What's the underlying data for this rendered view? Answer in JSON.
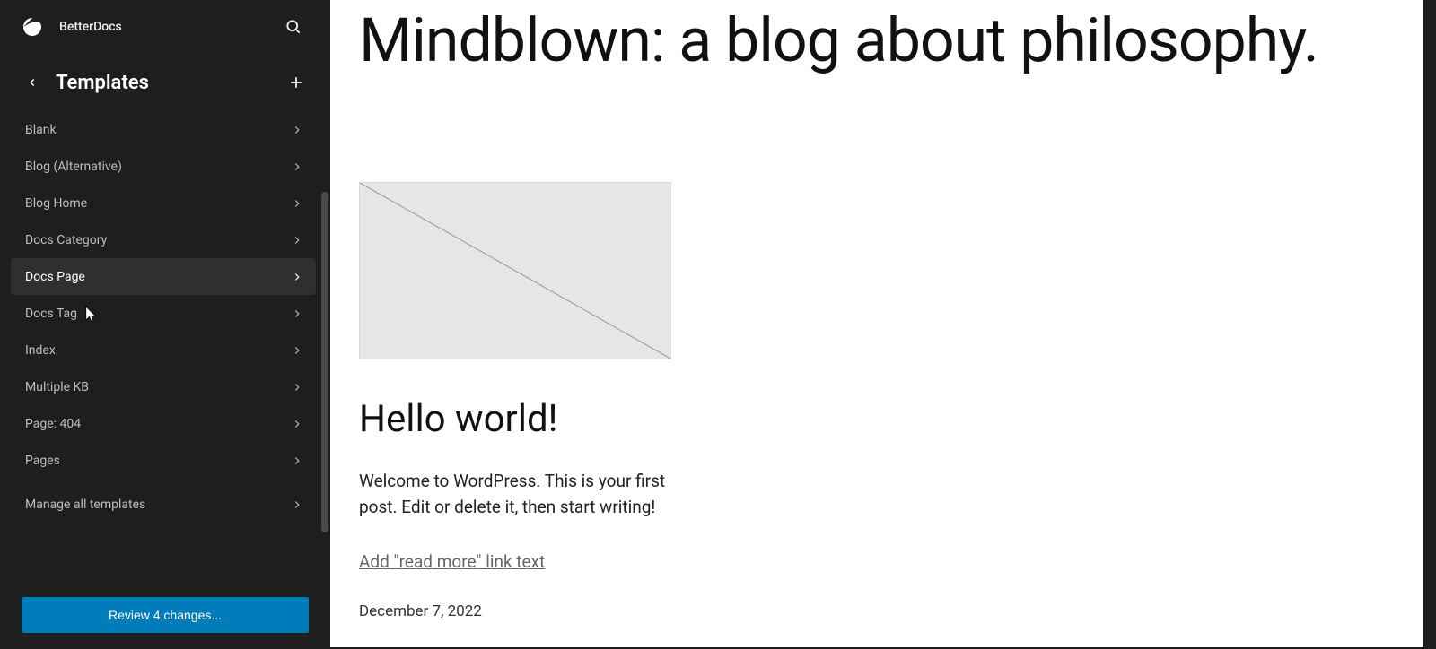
{
  "header": {
    "site_name": "BetterDocs"
  },
  "sidebar": {
    "title": "Templates",
    "items": [
      {
        "label": "Blank"
      },
      {
        "label": "Blog (Alternative)"
      },
      {
        "label": "Blog Home"
      },
      {
        "label": "Docs Category"
      },
      {
        "label": "Docs Page"
      },
      {
        "label": "Docs Tag"
      },
      {
        "label": "Index"
      },
      {
        "label": "Multiple KB"
      },
      {
        "label": "Page: 404"
      },
      {
        "label": "Pages"
      }
    ],
    "manage_label": "Manage all templates",
    "review_label": "Review 4 changes..."
  },
  "preview": {
    "hero": "Mindblown: a blog about philosophy.",
    "post": {
      "title": "Hello world!",
      "excerpt": "Welcome to WordPress. This is your first post. Edit or delete it, then start writing!",
      "readmore_placeholder": "Add \"read more\" link text",
      "date": "December 7, 2022"
    }
  }
}
